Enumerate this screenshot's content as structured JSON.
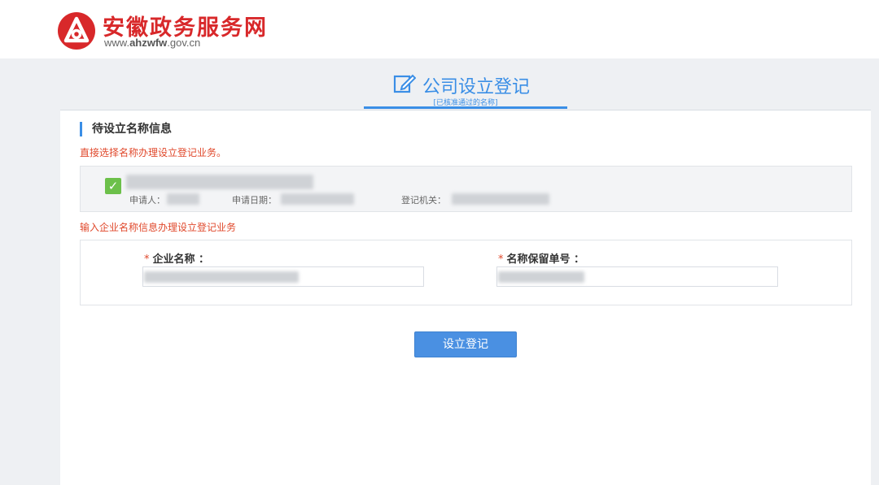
{
  "header": {
    "site_title": "安徽政务服务网",
    "site_url_prefix": "www.",
    "site_url_bold": "ahzwfw",
    "site_url_suffix": ".gov.cn",
    "logo_icon": "ahzwfw-logo",
    "brand_color": "#d8282a"
  },
  "page": {
    "title": "公司设立登记",
    "subtitle": "[已核准通过的名称]",
    "title_icon": "edit-icon",
    "accent_color": "#3a8ee6"
  },
  "pending": {
    "section_title": "待设立名称信息",
    "hint": "直接选择名称办理设立登记业务。",
    "checked": true,
    "applicant_label": "申请人：",
    "apply_date_label": "申请日期：",
    "authority_label": "登记机关："
  },
  "form": {
    "hint": "输入企业名称信息办理设立登记业务",
    "company_name_label": "企业名称 ：",
    "reservation_no_label": "名称保留单号 ：",
    "required_mark": "*",
    "company_name_value": "",
    "reservation_no_value": ""
  },
  "actions": {
    "submit_label": "设立登记"
  }
}
